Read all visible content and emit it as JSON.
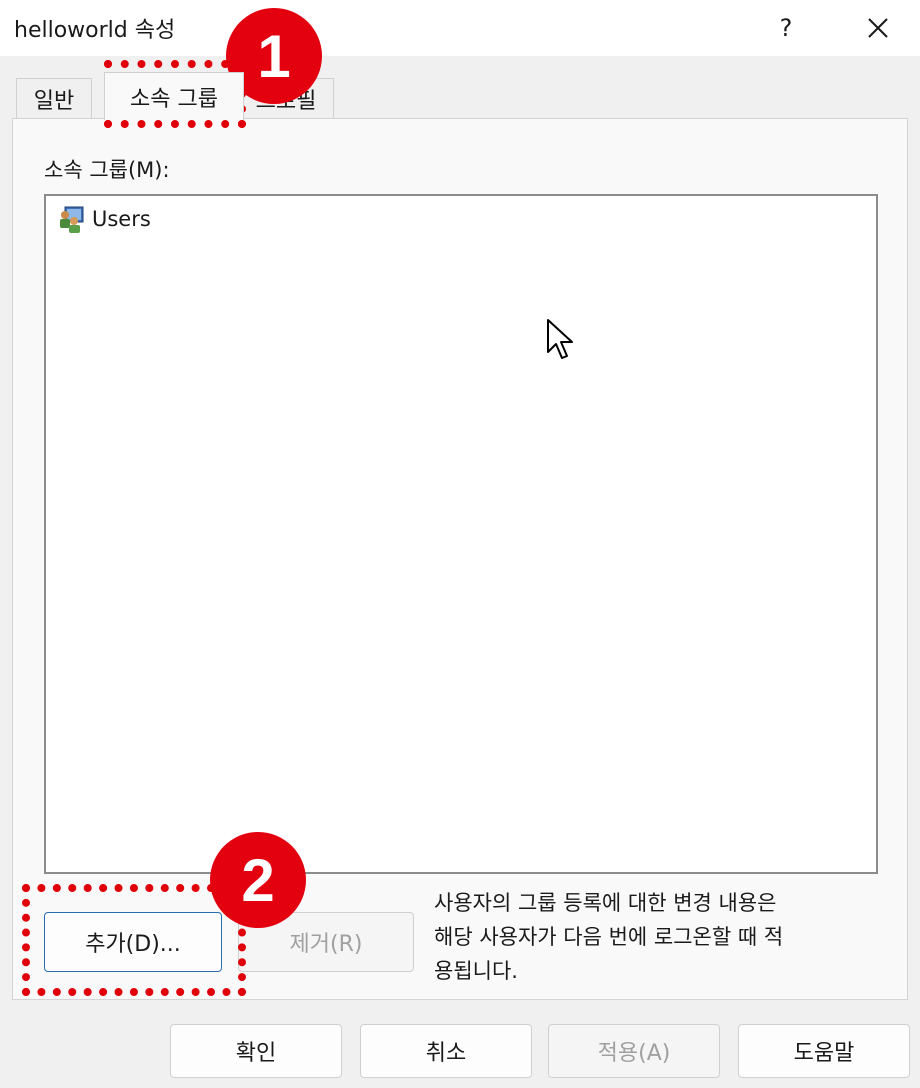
{
  "window": {
    "title": "helloworld 속성",
    "help_label": "?"
  },
  "tabs": [
    {
      "label": "일반"
    },
    {
      "label": "소속 그룹"
    },
    {
      "label": "프로필"
    }
  ],
  "group_section": {
    "label": "소속 그룹(M):",
    "items": [
      {
        "label": "Users",
        "icon": "users-group-icon"
      }
    ]
  },
  "buttons": {
    "add": "추가(D)...",
    "remove": "제거(R)",
    "ok": "확인",
    "cancel": "취소",
    "apply": "적용(A)",
    "help": "도움말"
  },
  "note": "사용자의 그룹 등록에 대한 변경 내용은\n해당 사용자가 다음 번에 로그온할 때 적\n용됩니다.",
  "annotations": {
    "badge1": "1",
    "badge2": "2",
    "color": "#e3000f"
  }
}
